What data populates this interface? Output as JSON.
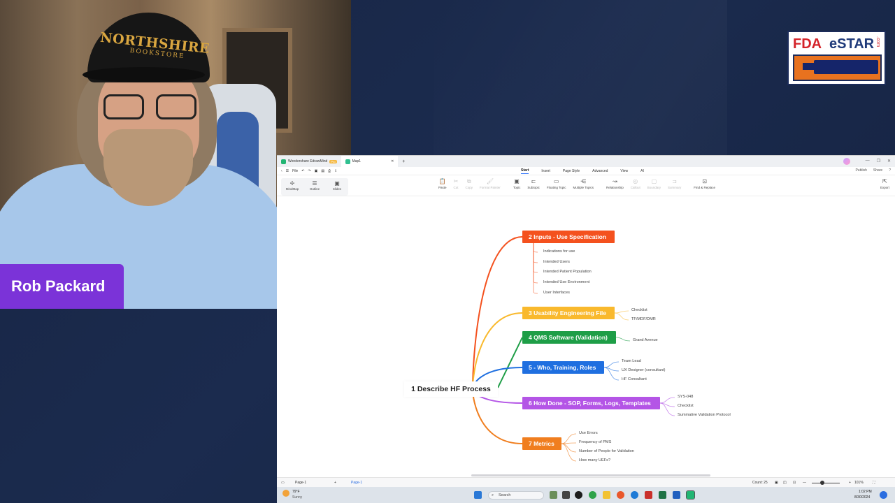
{
  "presenter": {
    "name": "Rob Packard",
    "cap_text": "NORTHSHIRE",
    "cap_subtext": "BOOKSTORE"
  },
  "logo": {
    "part1": "FDA",
    "part2": "eSTAR",
    "suffix": ".com",
    "colors": {
      "red": "#d4232a",
      "navy": "#1f3a7a",
      "orange": "#e8721f"
    }
  },
  "app": {
    "tabs": [
      {
        "label": "Wondershare EdrawMind",
        "badge": "Pro",
        "icon": "edrawmind-icon"
      },
      {
        "label": "Map1",
        "icon": "map-file-icon"
      }
    ],
    "menu": {
      "file_label": "File",
      "tabs": [
        "Start",
        "Insert",
        "Page Style",
        "Advanced",
        "View",
        "AI"
      ],
      "active_tab": "Start",
      "right": [
        "Publish",
        "Share"
      ]
    },
    "views": [
      {
        "label": "MindMap",
        "icon": "mindmap-icon"
      },
      {
        "label": "Outline",
        "icon": "outline-icon"
      },
      {
        "label": "Slides",
        "icon": "slides-icon"
      }
    ],
    "tools": [
      {
        "label": "Paste",
        "glyph": "📋",
        "enabled": true
      },
      {
        "label": "Cut",
        "glyph": "✂",
        "enabled": false
      },
      {
        "label": "Copy",
        "glyph": "⧉",
        "enabled": false
      },
      {
        "label": "Format Painter",
        "glyph": "🖌",
        "enabled": false
      },
      {
        "label": "Topic",
        "glyph": "▣",
        "enabled": true
      },
      {
        "label": "Subtopic",
        "glyph": "⊏",
        "enabled": true
      },
      {
        "label": "Floating Topic",
        "glyph": "▭",
        "enabled": true
      },
      {
        "label": "Multiple Topics",
        "glyph": "⋲",
        "enabled": true
      },
      {
        "label": "Relationship",
        "glyph": "↝",
        "enabled": true
      },
      {
        "label": "Callout",
        "glyph": "◎",
        "enabled": false
      },
      {
        "label": "Boundary",
        "glyph": "▢",
        "enabled": false
      },
      {
        "label": "Summary",
        "glyph": "⊐",
        "enabled": false
      },
      {
        "label": "Find & Replace",
        "glyph": "⊡",
        "enabled": true
      }
    ],
    "export_label": "Export",
    "mindmap": {
      "root": "1 Describe HF Process",
      "branches": [
        {
          "label": "2 Inputs - Use Specification",
          "color": "#f4511e",
          "children": [
            "Indications for use",
            "Intended Users",
            "Intended Patient Population",
            "Intended Use Environment",
            "User Interfaces"
          ]
        },
        {
          "label": "3 Usability Engineering File",
          "color": "#f9b92d",
          "children": [
            "Checklist",
            "TF/MDF/DMR"
          ]
        },
        {
          "label": "4 QMS Software (Validation)",
          "color": "#1e9e47",
          "children": [
            "Grand Avenue"
          ]
        },
        {
          "label": "5 - Who, Training, Roles",
          "color": "#1f6fe0",
          "children": [
            "Team Lead",
            "UX Designer (consultant)",
            "HF Consultant"
          ]
        },
        {
          "label": "6 How Done - SOP, Forms, Logs, Templates",
          "color": "#b455e6",
          "children": [
            "SYS-048",
            "Checklist",
            "Summative Validation Protocol"
          ]
        },
        {
          "label": "7 Metrics",
          "color": "#f07e1f",
          "children": [
            "Use Errors",
            "Frequency of PMS",
            "Number of People for Validation",
            "How many UEFs?"
          ]
        }
      ]
    },
    "status": {
      "page_select": "Page-1",
      "page_tab": "Page-1",
      "count": "Count: 25",
      "zoom": "101%"
    }
  },
  "taskbar": {
    "weather_temp": "79°F",
    "weather_desc": "Sunny",
    "search_placeholder": "Search",
    "time": "1:02 PM",
    "date": "8/30/2024"
  }
}
